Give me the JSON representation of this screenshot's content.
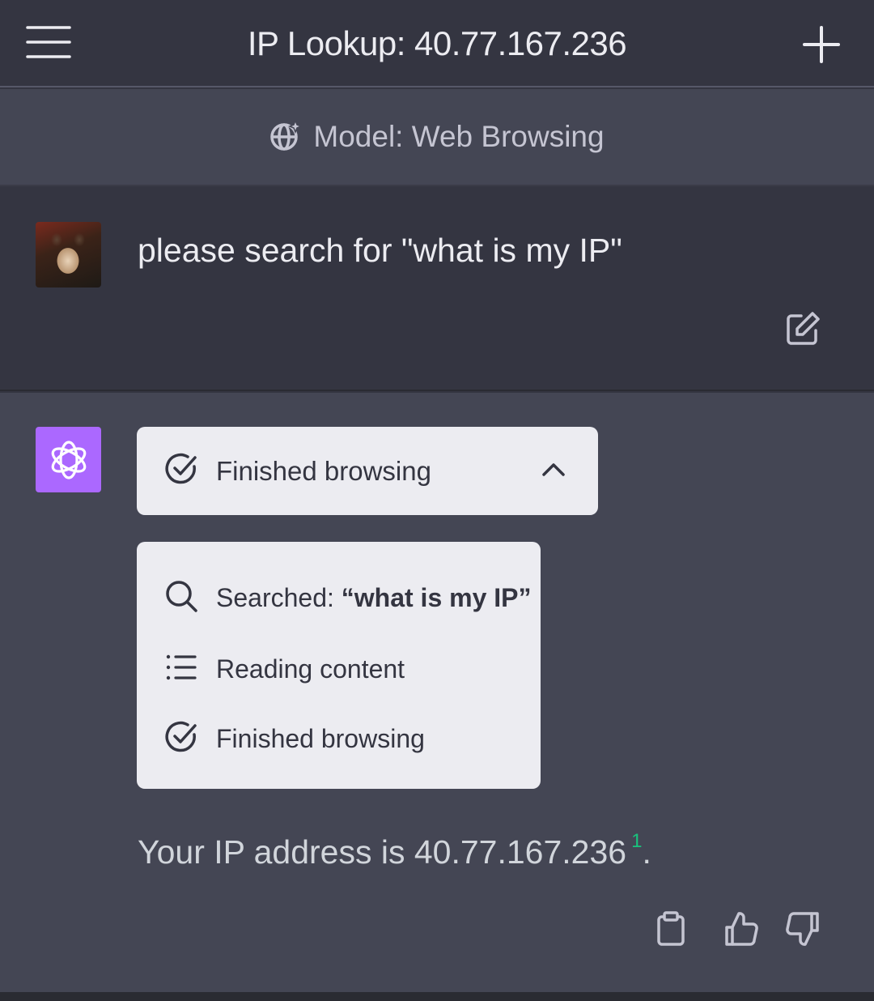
{
  "header": {
    "title": "IP Lookup: 40.77.167.236",
    "menu_icon": "hamburger-menu-icon",
    "new_chat_icon": "plus-icon"
  },
  "model_bar": {
    "label": "Model: Web Browsing",
    "icon": "globe-sparkle-icon"
  },
  "user_message": {
    "text": "please search for \"what is my IP\"",
    "edit_icon": "edit-icon"
  },
  "assistant_message": {
    "status": {
      "label": "Finished browsing",
      "icon": "check-circle-icon",
      "toggle_icon": "chevron-up-icon"
    },
    "steps": [
      {
        "icon": "search-icon",
        "prefix": "Searched: ",
        "query": "“what is my IP”"
      },
      {
        "icon": "list-icon",
        "prefix": "Reading content",
        "query": ""
      },
      {
        "icon": "check-circle-icon",
        "prefix": "Finished browsing",
        "query": ""
      }
    ],
    "answer_text": "Your IP address is 40.77.167.236",
    "citation": "1",
    "answer_end": ".",
    "actions": {
      "copy_icon": "clipboard-icon",
      "like_icon": "thumbs-up-icon",
      "dislike_icon": "thumbs-down-icon"
    }
  },
  "colors": {
    "background": "#343541",
    "assistant_background": "#444654",
    "card": "#ececf1",
    "bot_avatar": "#ab68ff",
    "citation": "#19c37d"
  }
}
